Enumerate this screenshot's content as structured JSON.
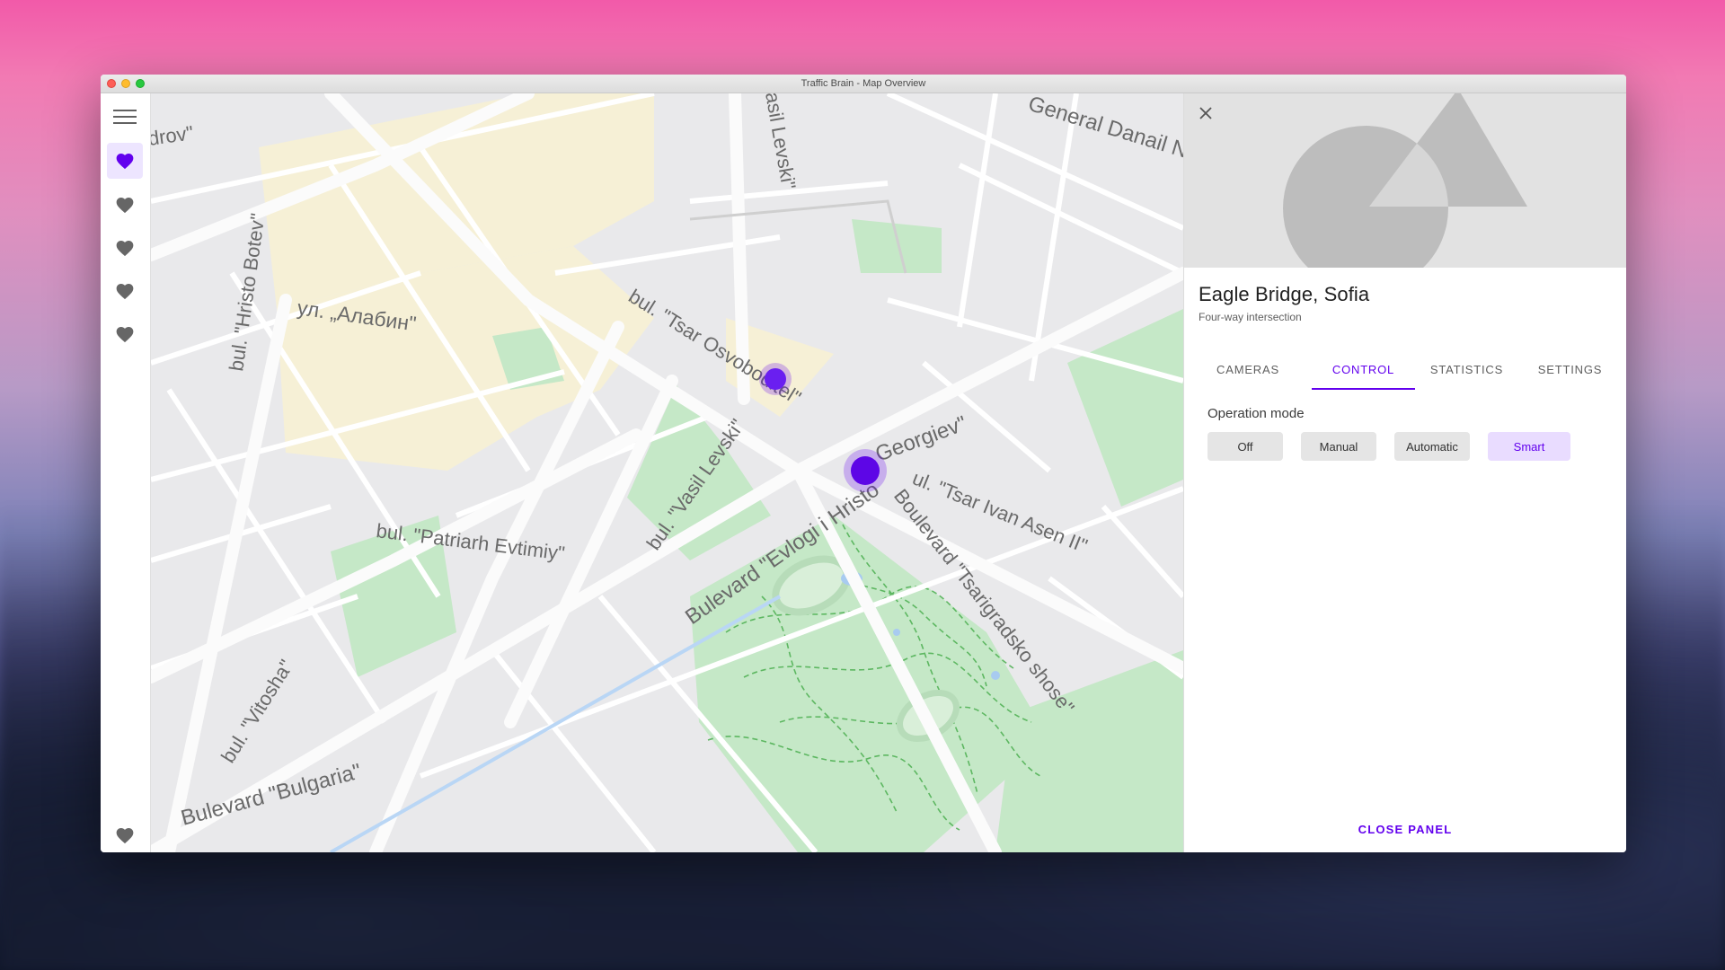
{
  "window": {
    "title": "Traffic Brain - Map Overview"
  },
  "rail": {
    "items": [
      {
        "icon": "menu-icon"
      },
      {
        "icon": "heart-icon",
        "active": true
      },
      {
        "icon": "heart-icon"
      },
      {
        "icon": "heart-icon"
      },
      {
        "icon": "heart-icon"
      },
      {
        "icon": "heart-icon"
      },
      {
        "icon": "heart-icon"
      }
    ]
  },
  "map": {
    "labels": {
      "drov": "drov\"",
      "general_danail": "General Danail N",
      "vasil_levski_top": "asil Levski\"",
      "hristo_botev": "bul. \"Hristo Botev\"",
      "alabin": "ул. „Алабин\"",
      "tsar_osvoboditel": "bul. \"Tsar Osvoboditel\"",
      "vasil_levski": "bul. \"Vasil Levski\"",
      "georgiev": "Georgiev\"",
      "tsar_ivan_asen": "ul. \"Tsar Ivan Asen II\"",
      "patriarh_evtimiy": "bul. \"Patriarh Evtimiy\"",
      "evlogi": "Bulevard \"Evlogi i Hristo",
      "tsarigradsko": "Boulevard \"Tsarigradsko shose\"",
      "vitosha": "bul. \"Vitosha\"",
      "bulgaria": "Bulevard \"Bulgaria\""
    },
    "marker_color": "#6200ee"
  },
  "panel": {
    "title": "Eagle Bridge, Sofia",
    "subtitle": "Four-way intersection",
    "tabs": [
      "CAMERAS",
      "CONTROL",
      "STATISTICS",
      "SETTINGS"
    ],
    "active_tab": "CONTROL",
    "operation_mode_label": "Operation mode",
    "modes": [
      "Off",
      "Manual",
      "Automatic",
      "Smart"
    ],
    "selected_mode": "Smart",
    "close_label": "CLOSE PANEL"
  },
  "colors": {
    "accent": "#6200ee",
    "accent_light": "#ede5ff"
  }
}
